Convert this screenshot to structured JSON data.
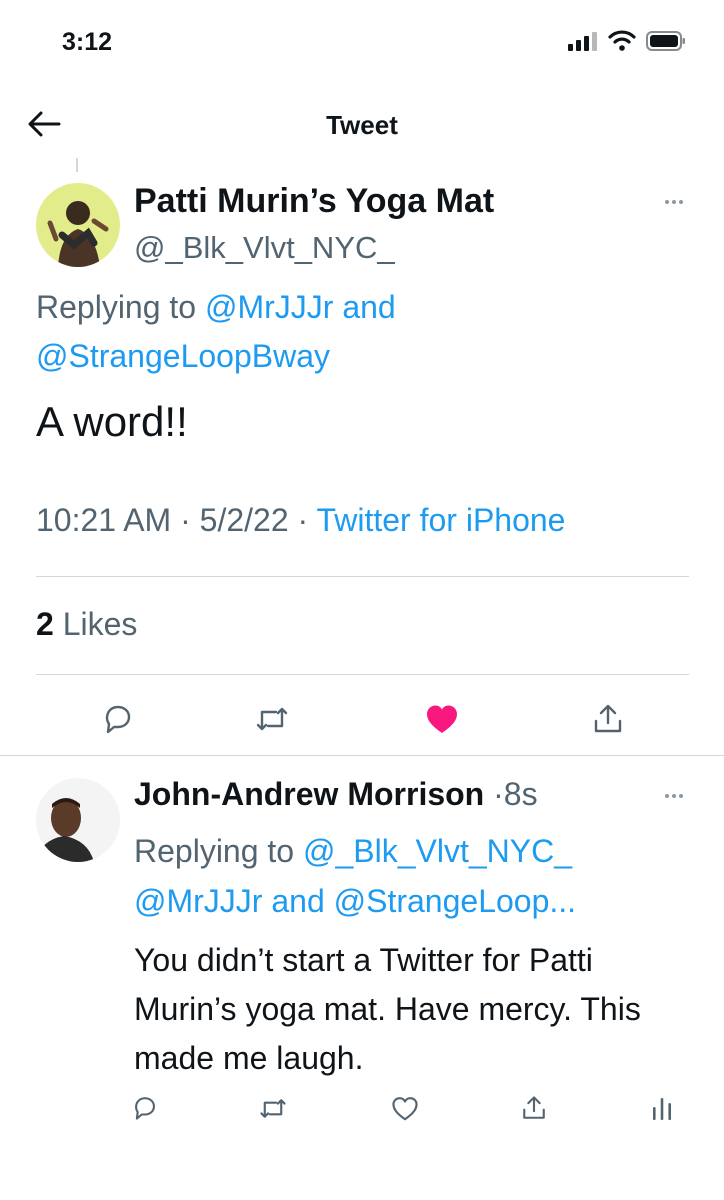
{
  "status_bar": {
    "time": "3:12"
  },
  "nav": {
    "title": "Tweet"
  },
  "main_tweet": {
    "author_name": "Patti Murin’s Yoga Mat",
    "author_handle": "@_Blk_Vlvt_NYC_",
    "replying_to_label": "Replying to",
    "replying_to_1": "@MrJJJr",
    "replying_to_and": "and",
    "replying_to_2": "@StrangeLoopBway",
    "text": "A word!!",
    "time": "10:21 AM",
    "date": "5/2/22",
    "separator": "·",
    "source": "Twitter for iPhone",
    "likes_count": "2",
    "likes_label": "Likes",
    "liked": true
  },
  "reply_tweet": {
    "author_name": "John-Andrew Morrison",
    "separator": "·",
    "time_ago": "8s",
    "replying_to_label": "Replying to",
    "replying_to_1": "@_Blk_Vlvt_NYC_",
    "replying_to_2": "@MrJJJr",
    "replying_to_and": "and",
    "replying_to_3": "@StrangeLoop...",
    "text": "You didn’t start a Twitter for Patti Murin’s yoga mat. Have mercy. This made me laugh."
  },
  "icons": {
    "back": "arrow-left-icon",
    "more": "more-icon",
    "reply": "reply-icon",
    "retweet": "retweet-icon",
    "like": "heart-icon",
    "share": "share-icon",
    "analytics": "analytics-icon",
    "signal": "signal-icon",
    "wifi": "wifi-icon",
    "battery": "battery-icon"
  },
  "colors": {
    "link": "#1d9bf0",
    "like_active": "#f91880",
    "secondary_text": "#536471",
    "primary_text": "#0f1419",
    "divider": "#cfd9de"
  }
}
